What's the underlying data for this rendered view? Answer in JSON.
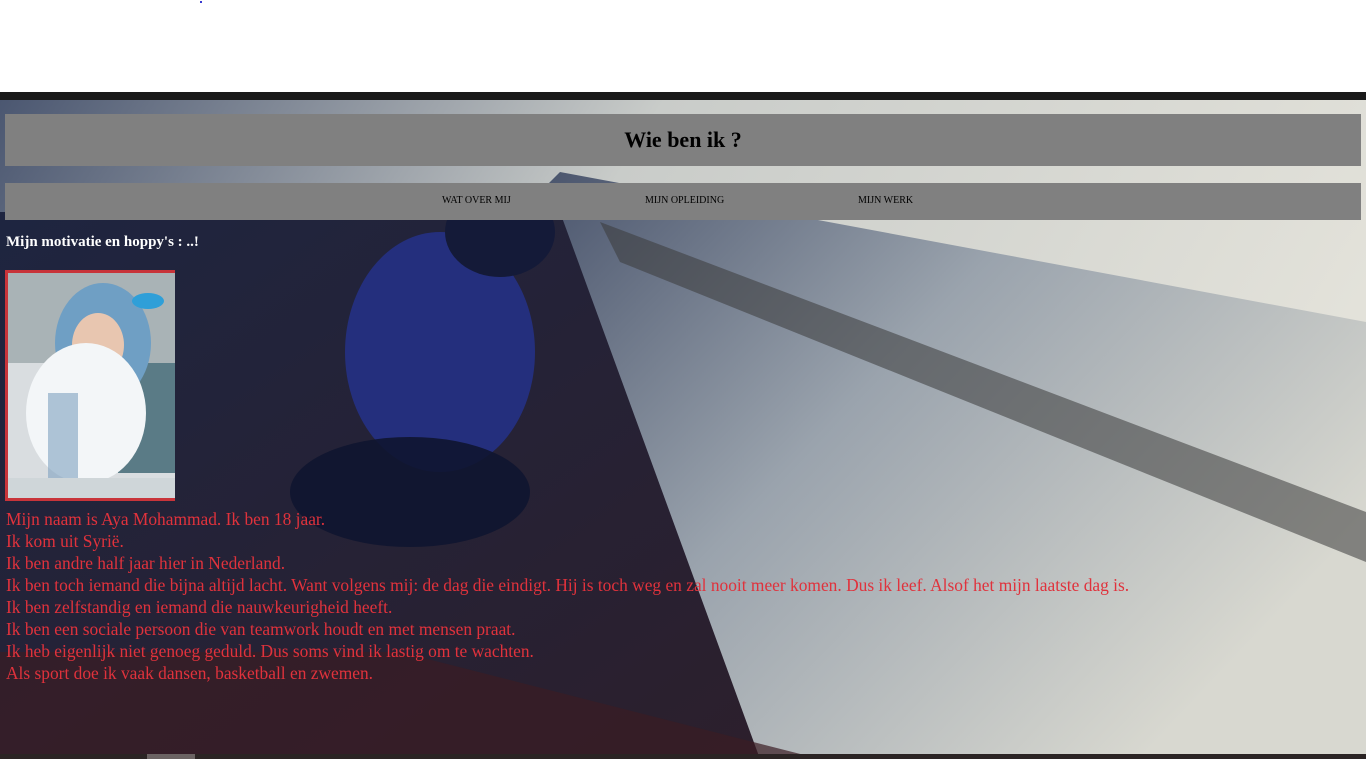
{
  "header": {
    "title": "Wie ben ik ?"
  },
  "nav": {
    "items": [
      {
        "label": "WAT OVER MIJ"
      },
      {
        "label": "MIJN OPLEIDING"
      },
      {
        "label": "MIJN WERK"
      }
    ]
  },
  "section": {
    "heading": "Mijn motivatie en hoppy's : ..!"
  },
  "about": {
    "lines": [
      "Mijn naam is Aya Mohammad. Ik ben 18 jaar.",
      "Ik kom uit Syrië.",
      "Ik ben andre half jaar hier in Nederland.",
      "Ik ben toch iemand die bijna altijd lacht. Want volgens mij: de dag die eindigt. Hij is toch weg en zal nooit meer komen. Dus ik leef. Alsof het mijn laatste dag is.",
      "Ik ben zelfstandig en iemand die nauwkeurigheid heeft.",
      "Ik ben een sociale persoon die van teamwork houdt en met mensen praat.",
      "Ik heb eigenlijk niet genoeg geduld. Dus soms vind ik lastig om te wachten.",
      "Als sport doe ik vaak dansen, basketball en zwemen."
    ]
  },
  "colors": {
    "bar_gray": "#808080",
    "text_red": "#e0323c",
    "frame_red": "#c8343a",
    "heading_white": "#ffffff"
  }
}
